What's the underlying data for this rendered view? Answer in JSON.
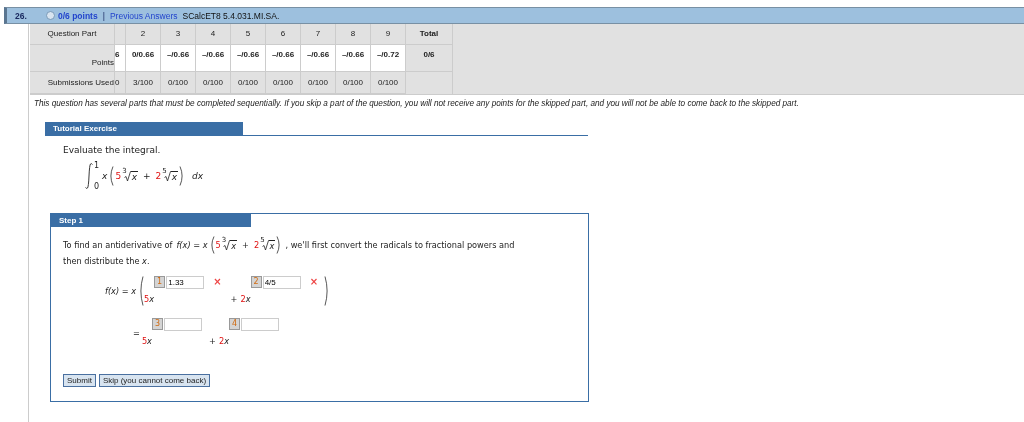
{
  "question": {
    "number": "26.",
    "points": "0/6 points",
    "separator": "|",
    "link": "Previous Answers",
    "code": "SCalcET8 5.4.031.MI.SA."
  },
  "table": {
    "columns": [
      "Question Part",
      "2",
      "3",
      "4",
      "5",
      "6",
      "7",
      "8",
      "9",
      "Total"
    ],
    "rows": [
      {
        "label": "Points",
        "cut": "6",
        "values": [
          "0/0.66",
          "–/0.66",
          "–/0.66",
          "–/0.66",
          "–/0.66",
          "–/0.66",
          "–/0.66",
          "–/0.72"
        ],
        "total": "0/6"
      },
      {
        "label": "Submissions Used",
        "cut": "0",
        "values": [
          "3/100",
          "0/100",
          "0/100",
          "0/100",
          "0/100",
          "0/100",
          "0/100",
          "0/100"
        ]
      }
    ]
  },
  "notice": "This question has several parts that must be completed sequentially. If you skip a part of the question, you will not receive any points for the skipped part, and you will not be able to come back to the skipped part.",
  "tutorial": {
    "title": "Tutorial Exercise",
    "prompt": "Evaluate the integral.",
    "lower": "0",
    "upper": "1",
    "factor": "x",
    "dx": "dx",
    "terms": [
      {
        "coef": "5",
        "index": "3",
        "radicand": "x"
      },
      {
        "op": "+",
        "coef": "2",
        "index": "5",
        "radicand": "x"
      }
    ]
  },
  "step": {
    "title": "Step 1",
    "text_before": "To find an antiderivative of",
    "fx": "f(x) = x",
    "terms": [
      {
        "coef": "5",
        "index": "3",
        "radicand": "x"
      },
      {
        "op": "+",
        "coef": "2",
        "index": "5",
        "radicand": "x"
      }
    ],
    "text_after": ", we'll first convert the radicals to fractional powers and",
    "text_line2": "then distribute the",
    "text_var": "x",
    "text_end": ".",
    "lines": [
      {
        "lead": "f(x) = x",
        "paren": true,
        "blanks": [
          {
            "coef": "5",
            "base": "x",
            "part": "1",
            "value": "1.33",
            "wrong": true,
            "mark": "×"
          },
          {
            "op": "+",
            "coef": "2",
            "base": "x",
            "part": "2",
            "value": "4/5",
            "wrong": true,
            "mark": "×"
          }
        ]
      },
      {
        "lead": "=",
        "paren": false,
        "blanks": [
          {
            "coef": "5",
            "base": "x",
            "part": "3",
            "wrong": false
          },
          {
            "op": "+",
            "coef": "2",
            "base": "x",
            "part": "4",
            "wrong": false
          }
        ]
      }
    ],
    "buttons": [
      "Submit",
      "Skip (you cannot come back)"
    ]
  }
}
